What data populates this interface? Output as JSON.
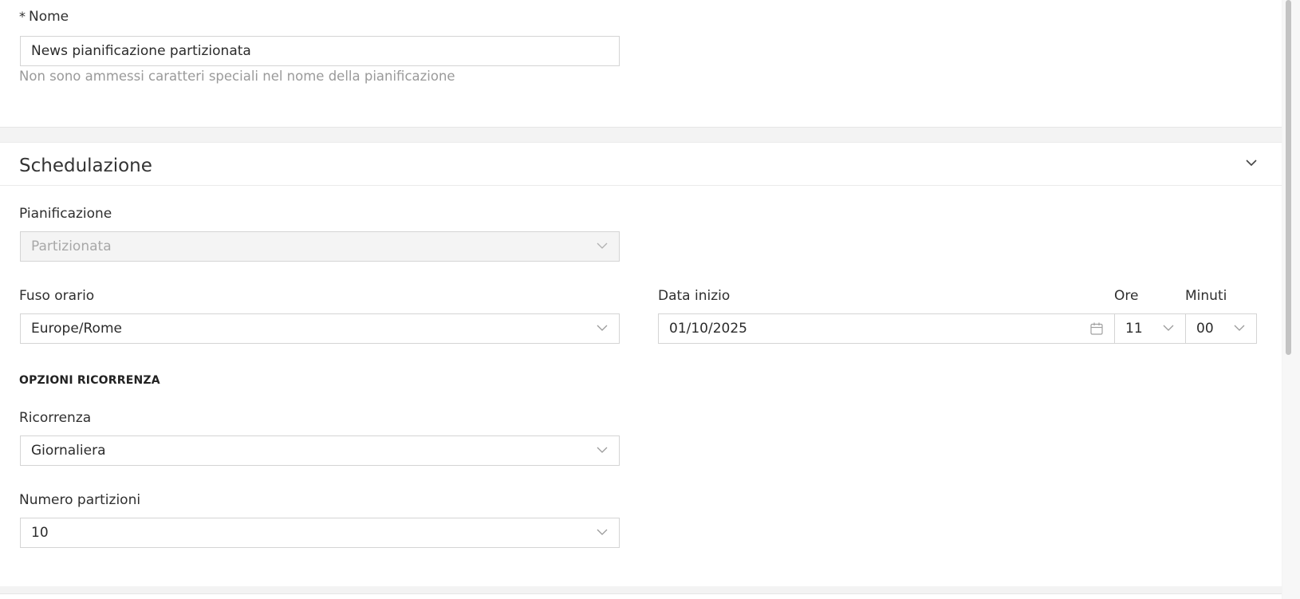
{
  "name_section": {
    "required_mark": "*",
    "label": "Nome",
    "value": "News pianificazione partizionata",
    "help": "Non sono ammessi caratteri speciali nel nome della pianificazione"
  },
  "schedule": {
    "title": "Schedulazione",
    "planning": {
      "label": "Pianificazione",
      "value": "Partizionata"
    },
    "timezone": {
      "label": "Fuso orario",
      "value": "Europe/Rome"
    },
    "start_date": {
      "label": "Data inizio",
      "value": "01/10/2025"
    },
    "hours": {
      "label": "Ore",
      "value": "11"
    },
    "minutes": {
      "label": "Minuti",
      "value": "00"
    },
    "recurrence_options_title": "OPZIONI RICORRENZA",
    "recurrence": {
      "label": "Ricorrenza",
      "value": "Giornaliera"
    },
    "partitions": {
      "label": "Numero partizioni",
      "value": "10"
    }
  },
  "icons": {
    "chevron": "chevron-down-icon",
    "calendar": "calendar-icon",
    "collapse": "collapse-chevron-icon"
  }
}
